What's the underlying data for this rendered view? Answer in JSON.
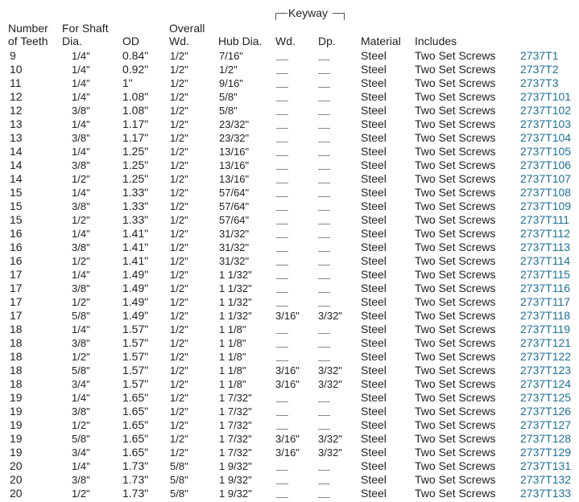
{
  "headers": {
    "number_of_teeth_1": "Number",
    "number_of_teeth_2": "of Teeth",
    "shaft_1": "For Shaft",
    "shaft_2": "Dia.",
    "od": "OD",
    "overall_1": "Overall",
    "overall_2": "Wd.",
    "hub": "Hub Dia.",
    "keyway": "Keyway",
    "keyway_wd": "Wd.",
    "keyway_dp": "Dp.",
    "material": "Material",
    "includes": "Includes"
  },
  "rows": [
    {
      "teeth": "9",
      "shaft": "1/4\"",
      "od": "0.84\"",
      "wd": "1/2\"",
      "hub": "7/16\"",
      "kwd": "",
      "kdp": "",
      "material": "Steel",
      "includes": "Two Set Screws",
      "part": "2737T1"
    },
    {
      "teeth": "10",
      "shaft": "1/4\"",
      "od": "0.92\"",
      "wd": "1/2\"",
      "hub": "1/2\"",
      "kwd": "",
      "kdp": "",
      "material": "Steel",
      "includes": "Two Set Screws",
      "part": "2737T2"
    },
    {
      "teeth": "11",
      "shaft": "1/4\"",
      "od": "1\"",
      "wd": "1/2\"",
      "hub": "9/16\"",
      "kwd": "",
      "kdp": "",
      "material": "Steel",
      "includes": "Two Set Screws",
      "part": "2737T3"
    },
    {
      "teeth": "12",
      "shaft": "1/4\"",
      "od": "1.08\"",
      "wd": "1/2\"",
      "hub": "5/8\"",
      "kwd": "",
      "kdp": "",
      "material": "Steel",
      "includes": "Two Set Screws",
      "part": "2737T101"
    },
    {
      "teeth": "12",
      "shaft": "3/8\"",
      "od": "1.08\"",
      "wd": "1/2\"",
      "hub": "5/8\"",
      "kwd": "",
      "kdp": "",
      "material": "Steel",
      "includes": "Two Set Screws",
      "part": "2737T102"
    },
    {
      "teeth": "13",
      "shaft": "1/4\"",
      "od": "1.17\"",
      "wd": "1/2\"",
      "hub": "23/32\"",
      "kwd": "",
      "kdp": "",
      "material": "Steel",
      "includes": "Two Set Screws",
      "part": "2737T103"
    },
    {
      "teeth": "13",
      "shaft": "3/8\"",
      "od": "1.17\"",
      "wd": "1/2\"",
      "hub": "23/32\"",
      "kwd": "",
      "kdp": "",
      "material": "Steel",
      "includes": "Two Set Screws",
      "part": "2737T104"
    },
    {
      "teeth": "14",
      "shaft": "1/4\"",
      "od": "1.25\"",
      "wd": "1/2\"",
      "hub": "13/16\"",
      "kwd": "",
      "kdp": "",
      "material": "Steel",
      "includes": "Two Set Screws",
      "part": "2737T105"
    },
    {
      "teeth": "14",
      "shaft": "3/8\"",
      "od": "1.25\"",
      "wd": "1/2\"",
      "hub": "13/16\"",
      "kwd": "",
      "kdp": "",
      "material": "Steel",
      "includes": "Two Set Screws",
      "part": "2737T106"
    },
    {
      "teeth": "14",
      "shaft": "1/2\"",
      "od": "1.25\"",
      "wd": "1/2\"",
      "hub": "13/16\"",
      "kwd": "",
      "kdp": "",
      "material": "Steel",
      "includes": "Two Set Screws",
      "part": "2737T107"
    },
    {
      "teeth": "15",
      "shaft": "1/4\"",
      "od": "1.33\"",
      "wd": "1/2\"",
      "hub": "57/64\"",
      "kwd": "",
      "kdp": "",
      "material": "Steel",
      "includes": "Two Set Screws",
      "part": "2737T108"
    },
    {
      "teeth": "15",
      "shaft": "3/8\"",
      "od": "1.33\"",
      "wd": "1/2\"",
      "hub": "57/64\"",
      "kwd": "",
      "kdp": "",
      "material": "Steel",
      "includes": "Two Set Screws",
      "part": "2737T109"
    },
    {
      "teeth": "15",
      "shaft": "1/2\"",
      "od": "1.33\"",
      "wd": "1/2\"",
      "hub": "57/64\"",
      "kwd": "",
      "kdp": "",
      "material": "Steel",
      "includes": "Two Set Screws",
      "part": "2737T111"
    },
    {
      "teeth": "16",
      "shaft": "1/4\"",
      "od": "1.41\"",
      "wd": "1/2\"",
      "hub": "31/32\"",
      "kwd": "",
      "kdp": "",
      "material": "Steel",
      "includes": "Two Set Screws",
      "part": "2737T112"
    },
    {
      "teeth": "16",
      "shaft": "3/8\"",
      "od": "1.41\"",
      "wd": "1/2\"",
      "hub": "31/32\"",
      "kwd": "",
      "kdp": "",
      "material": "Steel",
      "includes": "Two Set Screws",
      "part": "2737T113"
    },
    {
      "teeth": "16",
      "shaft": "1/2\"",
      "od": "1.41\"",
      "wd": "1/2\"",
      "hub": "31/32\"",
      "kwd": "",
      "kdp": "",
      "material": "Steel",
      "includes": "Two Set Screws",
      "part": "2737T114"
    },
    {
      "teeth": "17",
      "shaft": "1/4\"",
      "od": "1.49\"",
      "wd": "1/2\"",
      "hub": "1 1/32\"",
      "kwd": "",
      "kdp": "",
      "material": "Steel",
      "includes": "Two Set Screws",
      "part": "2737T115"
    },
    {
      "teeth": "17",
      "shaft": "3/8\"",
      "od": "1.49\"",
      "wd": "1/2\"",
      "hub": "1 1/32\"",
      "kwd": "",
      "kdp": "",
      "material": "Steel",
      "includes": "Two Set Screws",
      "part": "2737T116"
    },
    {
      "teeth": "17",
      "shaft": "1/2\"",
      "od": "1.49\"",
      "wd": "1/2\"",
      "hub": "1 1/32\"",
      "kwd": "",
      "kdp": "",
      "material": "Steel",
      "includes": "Two Set Screws",
      "part": "2737T117"
    },
    {
      "teeth": "17",
      "shaft": "5/8\"",
      "od": "1.49\"",
      "wd": "1/2\"",
      "hub": "1 1/32\"",
      "kwd": "3/16\"",
      "kdp": "3/32\"",
      "material": "Steel",
      "includes": "Two Set Screws",
      "part": "2737T118"
    },
    {
      "teeth": "18",
      "shaft": "1/4\"",
      "od": "1.57\"",
      "wd": "1/2\"",
      "hub": "1 1/8\"",
      "kwd": "",
      "kdp": "",
      "material": "Steel",
      "includes": "Two Set Screws",
      "part": "2737T119"
    },
    {
      "teeth": "18",
      "shaft": "3/8\"",
      "od": "1.57\"",
      "wd": "1/2\"",
      "hub": "1 1/8\"",
      "kwd": "",
      "kdp": "",
      "material": "Steel",
      "includes": "Two Set Screws",
      "part": "2737T121"
    },
    {
      "teeth": "18",
      "shaft": "1/2\"",
      "od": "1.57\"",
      "wd": "1/2\"",
      "hub": "1 1/8\"",
      "kwd": "",
      "kdp": "",
      "material": "Steel",
      "includes": "Two Set Screws",
      "part": "2737T122"
    },
    {
      "teeth": "18",
      "shaft": "5/8\"",
      "od": "1.57\"",
      "wd": "1/2\"",
      "hub": "1 1/8\"",
      "kwd": "3/16\"",
      "kdp": "3/32\"",
      "material": "Steel",
      "includes": "Two Set Screws",
      "part": "2737T123"
    },
    {
      "teeth": "18",
      "shaft": "3/4\"",
      "od": "1.57\"",
      "wd": "1/2\"",
      "hub": "1 1/8\"",
      "kwd": "3/16\"",
      "kdp": "3/32\"",
      "material": "Steel",
      "includes": "Two Set Screws",
      "part": "2737T124"
    },
    {
      "teeth": "19",
      "shaft": "1/4\"",
      "od": "1.65\"",
      "wd": "1/2\"",
      "hub": "1 7/32\"",
      "kwd": "",
      "kdp": "",
      "material": "Steel",
      "includes": "Two Set Screws",
      "part": "2737T125"
    },
    {
      "teeth": "19",
      "shaft": "3/8\"",
      "od": "1.65\"",
      "wd": "1/2\"",
      "hub": "1 7/32\"",
      "kwd": "",
      "kdp": "",
      "material": "Steel",
      "includes": "Two Set Screws",
      "part": "2737T126"
    },
    {
      "teeth": "19",
      "shaft": "1/2\"",
      "od": "1.65\"",
      "wd": "1/2\"",
      "hub": "1 7/32\"",
      "kwd": "",
      "kdp": "",
      "material": "Steel",
      "includes": "Two Set Screws",
      "part": "2737T127"
    },
    {
      "teeth": "19",
      "shaft": "5/8\"",
      "od": "1.65\"",
      "wd": "1/2\"",
      "hub": "1 7/32\"",
      "kwd": "3/16\"",
      "kdp": "3/32\"",
      "material": "Steel",
      "includes": "Two Set Screws",
      "part": "2737T128"
    },
    {
      "teeth": "19",
      "shaft": "3/4\"",
      "od": "1.65\"",
      "wd": "1/2\"",
      "hub": "1 7/32\"",
      "kwd": "3/16\"",
      "kdp": "3/32\"",
      "material": "Steel",
      "includes": "Two Set Screws",
      "part": "2737T129"
    },
    {
      "teeth": "20",
      "shaft": "1/4\"",
      "od": "1.73\"",
      "wd": "5/8\"",
      "hub": "1 9/32\"",
      "kwd": "",
      "kdp": "",
      "material": "Steel",
      "includes": "Two Set Screws",
      "part": "2737T131"
    },
    {
      "teeth": "20",
      "shaft": "3/8\"",
      "od": "1.73\"",
      "wd": "5/8\"",
      "hub": "1 9/32\"",
      "kwd": "",
      "kdp": "",
      "material": "Steel",
      "includes": "Two Set Screws",
      "part": "2737T132"
    },
    {
      "teeth": "20",
      "shaft": "1/2\"",
      "od": "1.73\"",
      "wd": "5/8\"",
      "hub": "1 9/32\"",
      "kwd": "",
      "kdp": "",
      "material": "Steel",
      "includes": "Two Set Screws",
      "part": "2737T133"
    }
  ]
}
